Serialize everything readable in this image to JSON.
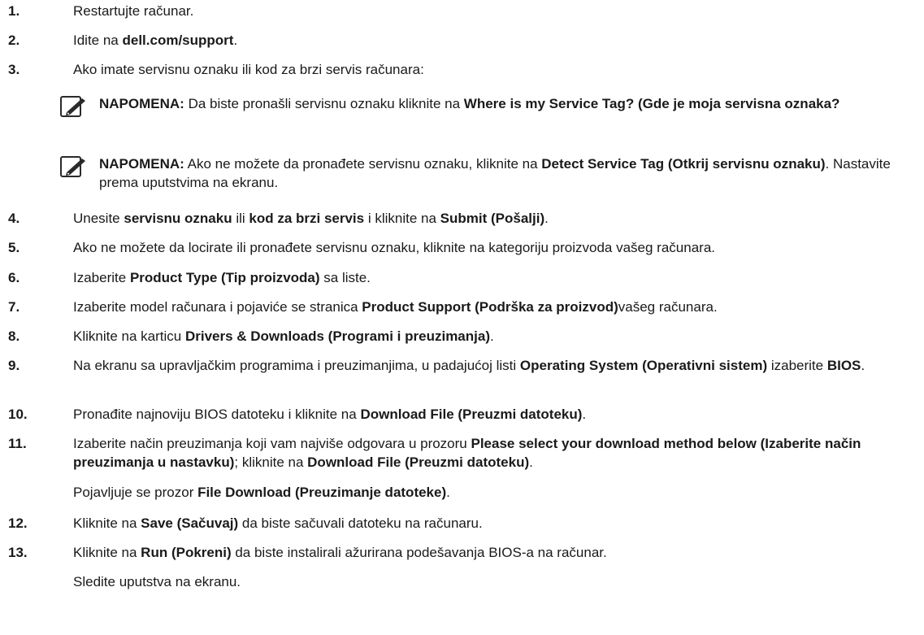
{
  "steps": [
    {
      "n": "1.",
      "parts": [
        {
          "t": "Restartujte računar."
        }
      ]
    },
    {
      "n": "2.",
      "parts": [
        {
          "t": "Idite na "
        },
        {
          "t": "dell.com/support",
          "b": true
        },
        {
          "t": "."
        }
      ]
    },
    {
      "n": "3.",
      "parts": [
        {
          "t": "Ako imate servisnu oznaku ili kod za brzi servis računara:"
        }
      ]
    },
    {
      "n": "4.",
      "parts": [
        {
          "t": "Unesite "
        },
        {
          "t": "servisnu oznaku",
          "b": true
        },
        {
          "t": " ili "
        },
        {
          "t": "kod za brzi servis",
          "b": true
        },
        {
          "t": " i kliknite na "
        },
        {
          "t": "Submit (Pošalji)",
          "b": true
        },
        {
          "t": "."
        }
      ]
    },
    {
      "n": "5.",
      "parts": [
        {
          "t": "Ako ne možete da locirate ili pronađete servisnu oznaku, kliknite na kategoriju proizvoda vašeg računara."
        }
      ]
    },
    {
      "n": "6.",
      "parts": [
        {
          "t": "Izaberite "
        },
        {
          "t": "Product Type (Tip proizvoda)",
          "b": true
        },
        {
          "t": " sa liste."
        }
      ]
    },
    {
      "n": "7.",
      "parts": [
        {
          "t": "Izaberite model računara i pojaviće se stranica "
        },
        {
          "t": "Product Support (Podrška za proizvod)",
          "b": true
        },
        {
          "t": "vašeg računara."
        }
      ]
    },
    {
      "n": "8.",
      "parts": [
        {
          "t": "Kliknite na karticu "
        },
        {
          "t": "Drivers & Downloads (Programi i preuzimanja)",
          "b": true
        },
        {
          "t": "."
        }
      ]
    },
    {
      "n": "9.",
      "parts": [
        {
          "t": "Na ekranu sa upravljačkim programima i preuzimanjima, u padajućoj listi "
        },
        {
          "t": "Operating System (Operativni sistem)",
          "b": true
        },
        {
          "t": " izaberite "
        },
        {
          "t": "BIOS",
          "b": true
        },
        {
          "t": "."
        }
      ]
    },
    {
      "n": "10.",
      "parts": [
        {
          "t": "Pronađite najnoviju BIOS datoteku i kliknite na "
        },
        {
          "t": "Download File (Preuzmi datoteku)",
          "b": true
        },
        {
          "t": "."
        }
      ]
    },
    {
      "n": "11.",
      "parts": [
        {
          "t": "Izaberite način preuzimanja koji vam najviše odgovara u prozoru "
        },
        {
          "t": "Please select your download method below (Izaberite način preuzimanja u nastavku)",
          "b": true
        },
        {
          "t": "; kliknite na "
        },
        {
          "t": "Download File (Preuzmi datoteku)",
          "b": true
        },
        {
          "t": "."
        }
      ]
    },
    {
      "n": "12.",
      "parts": [
        {
          "t": "Kliknite na "
        },
        {
          "t": "Save (Sačuvaj)",
          "b": true
        },
        {
          "t": " da biste sačuvali datoteku na računaru."
        }
      ]
    },
    {
      "n": "13.",
      "parts": [
        {
          "t": "Kliknite na "
        },
        {
          "t": "Run (Pokreni)",
          "b": true
        },
        {
          "t": " da biste instalirali ažurirana podešavanja BIOS-a na računar."
        }
      ]
    }
  ],
  "notes": [
    {
      "icon": "pencil-note-icon",
      "parts": [
        {
          "t": "NAPOMENA:",
          "b": true
        },
        {
          "t": " Da biste pronašli servisnu oznaku kliknite na "
        },
        {
          "t": "Where is my Service Tag? (Gde je moja servisna oznaka?",
          "b": true
        }
      ]
    },
    {
      "icon": "pencil-note-icon",
      "parts": [
        {
          "t": "NAPOMENA:",
          "b": true
        },
        {
          "t": " Ako ne možete da pronađete servisnu oznaku, kliknite na "
        },
        {
          "t": "Detect Service Tag (Otkrij servisnu oznaku)",
          "b": true
        },
        {
          "t": ". Nastavite prema uputstvima na ekranu."
        }
      ]
    }
  ],
  "continuations": {
    "after_11": [
      {
        "t": "Pojavljuje se prozor "
      },
      {
        "t": "File Download (Preuzimanje datoteke)",
        "b": true
      },
      {
        "t": "."
      }
    ],
    "after_13": [
      {
        "t": "Sledite uputstva na ekranu."
      }
    ]
  }
}
